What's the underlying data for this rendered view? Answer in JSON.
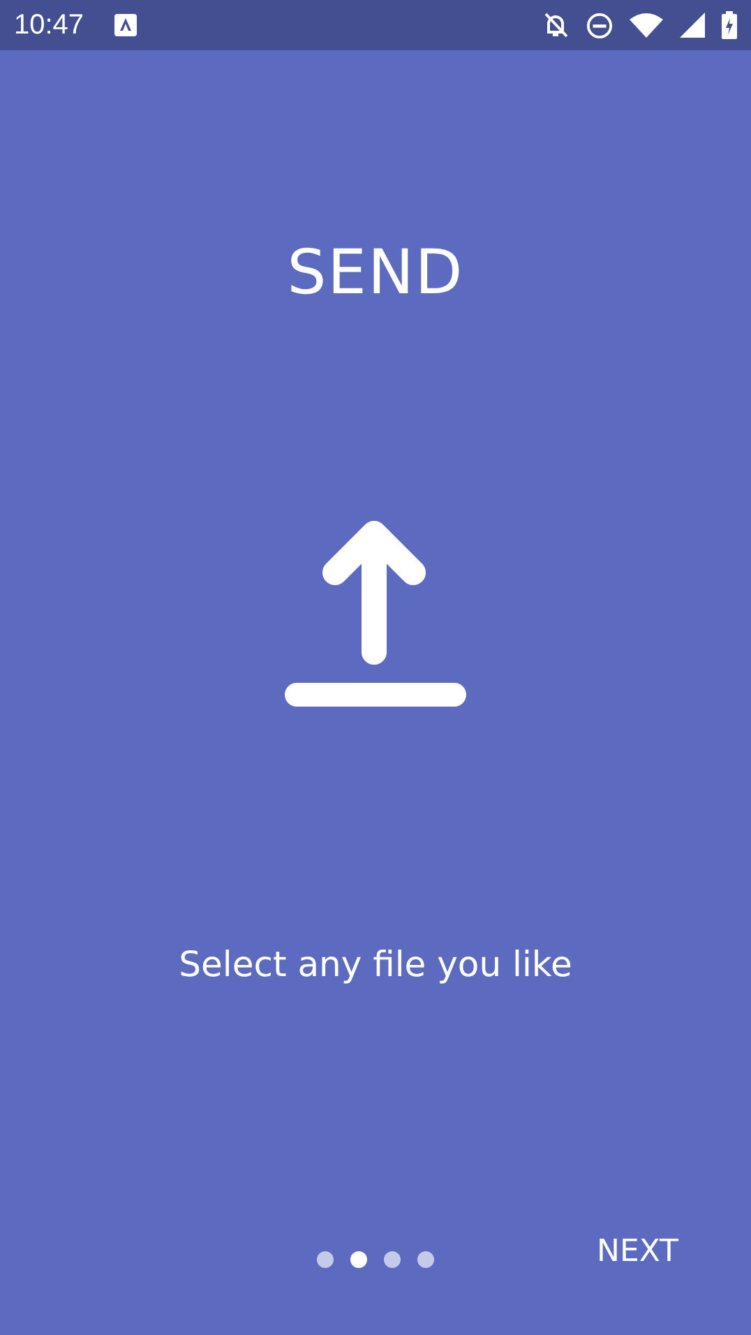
{
  "status_bar": {
    "time": "10:47"
  },
  "title": "SEND",
  "caption": "Select any file you like",
  "pager": [
    {
      "selected": false
    },
    {
      "selected": true
    },
    {
      "selected": false
    },
    {
      "selected": false
    }
  ],
  "next_button": "NEXT"
}
